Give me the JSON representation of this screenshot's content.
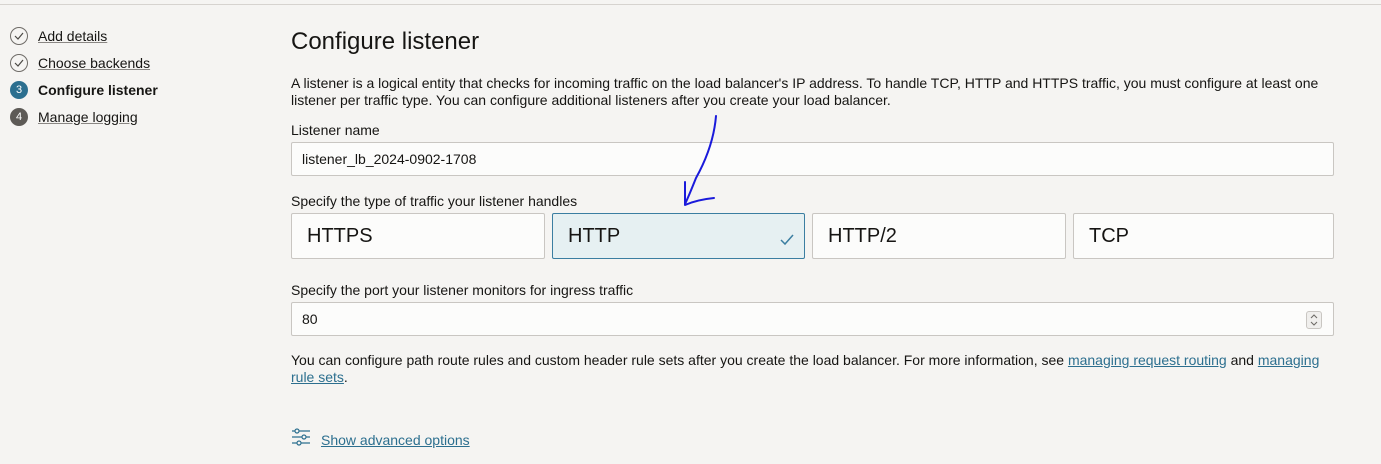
{
  "steps": [
    {
      "number": "",
      "label": "Add details",
      "state": "done"
    },
    {
      "number": "",
      "label": "Choose backends",
      "state": "done"
    },
    {
      "number": "3",
      "label": "Configure listener",
      "state": "current"
    },
    {
      "number": "4",
      "label": "Manage logging",
      "state": "todo"
    }
  ],
  "main": {
    "title": "Configure listener",
    "description": "A listener is a logical entity that checks for incoming traffic on the load balancer's IP address. To handle TCP, HTTP and HTTPS traffic, you must configure at least one listener per traffic type. You can configure additional listeners after you create your load balancer.",
    "listener_name": {
      "label": "Listener name",
      "value": "listener_lb_2024-0902-1708"
    },
    "traffic_type": {
      "label": "Specify the type of traffic your listener handles",
      "options": [
        "HTTPS",
        "HTTP",
        "HTTP/2",
        "TCP"
      ],
      "selected": "HTTP"
    },
    "port": {
      "label": "Specify the port your listener monitors for ingress traffic",
      "value": "80"
    },
    "info": {
      "text_before": "You can configure path route rules and custom header rule sets after you create the load balancer. For more information, see ",
      "link1": "managing request routing",
      "text_middle": " and ",
      "link2": "managing rule sets",
      "text_after": "."
    },
    "advanced_options_label": "Show advanced options"
  },
  "colors": {
    "accent": "#2c6f8f",
    "selected_tile_border": "#3b7ea1",
    "selected_tile_bg": "#e6f0f2",
    "annotation": "#1a1adb"
  },
  "icons": {
    "step_done": "check-circle-icon",
    "tile_selected": "checkmark-icon",
    "advanced_options": "sliders-icon",
    "stepper": "chevron-up-down-icon"
  }
}
